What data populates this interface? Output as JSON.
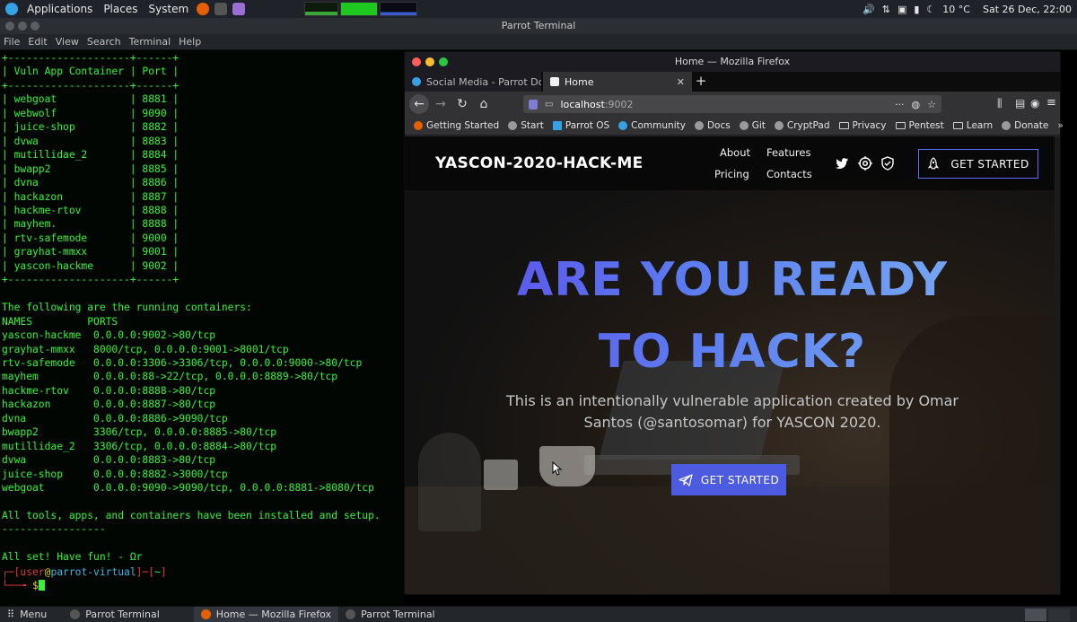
{
  "top_panel": {
    "menus": [
      "Applications",
      "Places",
      "System"
    ],
    "weather": "10 °C",
    "datetime": "Sat 26 Dec, 22:00"
  },
  "terminal": {
    "window_title": "Parrot Terminal",
    "menu": [
      "File",
      "Edit",
      "View",
      "Search",
      "Terminal",
      "Help"
    ],
    "output": "+--------------------+------+\n| Vuln App Container | Port |\n+--------------------+------+\n| webgoat            | 8881 |\n| webwolf            | 9090 |\n| juice-shop         | 8882 |\n| dvwa               | 8883 |\n| mutillidae_2       | 8884 |\n| bwapp2             | 8885 |\n| dvna               | 8886 |\n| hackazon           | 8887 |\n| hackme-rtov        | 8888 |\n| mayhem.            | 8888 |\n| rtv-safemode       | 9000 |\n| grayhat-mmxx       | 9001 |\n| yascon-hackme      | 9002 |\n+--------------------+------+\n\nThe following are the running containers:\nNAMES         PORTS\nyascon-hackme  0.0.0.0:9002->80/tcp\ngrayhat-mmxx   8000/tcp, 0.0.0.0:9001->8001/tcp\nrtv-safemode   0.0.0.0:3306->3306/tcp, 0.0.0.0:9000->80/tcp\nmayhem         0.0.0.0:88->22/tcp, 0.0.0.0:8889->80/tcp\nhackme-rtov    0.0.0.0:8888->80/tcp\nhackazon       0.0.0.0:8887->80/tcp\ndvna           0.0.0.0:8886->9090/tcp\nbwapp2         3306/tcp, 0.0.0.0:8885->80/tcp\nmutillidae_2   3306/tcp, 0.0.0.0:8884->80/tcp\ndvwa           0.0.0.0:8883->80/tcp\njuice-shop     0.0.0.0:8882->3000/tcp\nwebgoat        0.0.0.0:9090->9090/tcp, 0.0.0.0:8881->8080/tcp\n\nAll tools, apps, and containers have been installed and setup.\n-----------------\n\nAll set! Have fun! - Ωr",
    "prompt_user": "user",
    "prompt_host": "parrot-virtual",
    "prompt_dir": "~",
    "prompt_symbol": "$"
  },
  "firefox": {
    "window_title": "Home — Mozilla Firefox",
    "tabs": [
      {
        "label": "Social Media - Parrot Do"
      },
      {
        "label": "Home"
      }
    ],
    "url_host": "localhost",
    "url_port": ":9002",
    "bookmarks": [
      "Getting Started",
      "Start",
      "Parrot OS",
      "Community",
      "Docs",
      "Git",
      "CryptPad",
      "Privacy",
      "Pentest",
      "Learn",
      "Donate"
    ]
  },
  "page": {
    "logo": "YASCON-2020-HACK-ME",
    "nav": [
      "About",
      "Features",
      "Pricing",
      "Contacts"
    ],
    "nav_cta": "GET STARTED",
    "hero_title_line1": "ARE YOU READY",
    "hero_title_line2": "TO HACK?",
    "hero_subtitle": "This is an intentionally vulnerable application created by Omar Santos (@santosomar) for YASCON 2020.",
    "hero_cta": "GET STARTED"
  },
  "taskbar": {
    "menu": "Menu",
    "items": [
      "Parrot Terminal",
      "Home — Mozilla Firefox",
      "Parrot Terminal"
    ]
  },
  "colors": {
    "terminal_green": "#33f433",
    "accent": "#4d5be0"
  }
}
